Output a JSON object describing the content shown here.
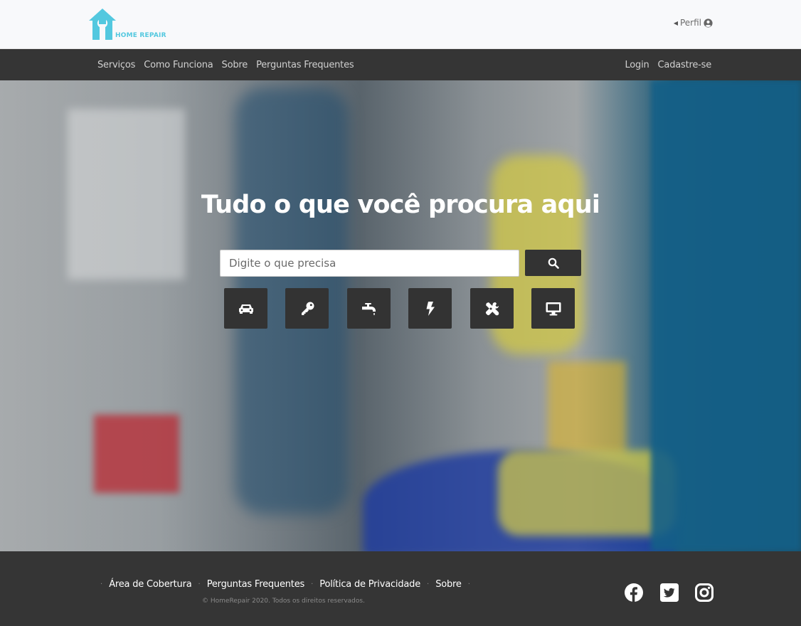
{
  "header": {
    "logo_text": "HOME REPAIR",
    "profile_label": "Perfil"
  },
  "nav": {
    "left": [
      "Serviços",
      "Como Funciona",
      "Sobre",
      "Perguntas Frequentes"
    ],
    "right": [
      "Login",
      "Cadastre-se"
    ]
  },
  "hero": {
    "title": "Tudo o que você procura aqui",
    "search_placeholder": "Digite o que precisa",
    "categories": [
      "car-icon",
      "key-icon",
      "faucet-icon",
      "bolt-icon",
      "tools-icon",
      "monitor-icon"
    ]
  },
  "footer": {
    "links": [
      "Área de Cobertura",
      "Perguntas Frequentes",
      "Política de Privacidade",
      "Sobre"
    ],
    "copyright": "© HomeRepair 2020. Todos os direitos reservados.",
    "social": [
      "facebook-icon",
      "twitter-icon",
      "instagram-icon"
    ]
  },
  "colors": {
    "brand": "#53c8df",
    "dark_bar": "#353535",
    "button": "#333333"
  }
}
